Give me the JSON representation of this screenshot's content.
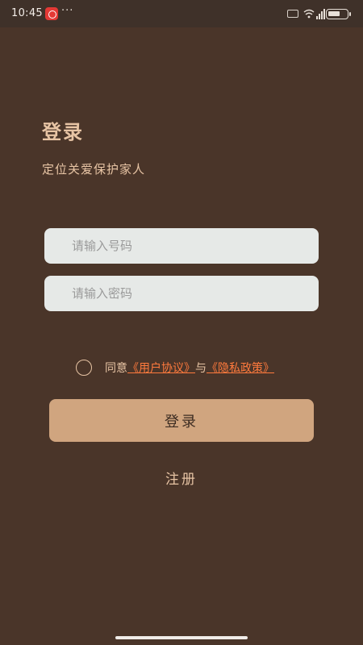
{
  "status_bar": {
    "time": "10:45",
    "more": "···",
    "icons": [
      "app-notification-icon",
      "hd-icon",
      "wifi-icon",
      "signal-icon",
      "battery-icon"
    ]
  },
  "login": {
    "title": "登录",
    "subtitle": "定位关爱保护家人",
    "phone_placeholder": "请输入号码",
    "password_placeholder": "请输入密码",
    "agree_prefix": "同意",
    "user_agreement": "《用户协议》",
    "agree_joiner": "与",
    "privacy_policy": "《隐私政策》",
    "login_button": "登录",
    "register_link": "注册"
  },
  "colors": {
    "background": "#4a3529",
    "accent_text": "#e7c4a4",
    "button": "#d0a57f",
    "link": "#ff7a3d",
    "input": "#e6e9e7"
  }
}
